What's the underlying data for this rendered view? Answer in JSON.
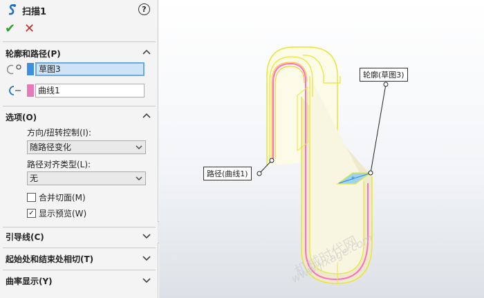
{
  "feature": {
    "title": "扫描1",
    "help": "?",
    "ok_icon": "checkmark-icon",
    "cancel_icon": "close-icon"
  },
  "profile_path": {
    "title": "轮廓和路径(P)",
    "profile": {
      "value": "草图3",
      "color": "#3d8fe0"
    },
    "path": {
      "value": "曲线1",
      "color": "#e879b8"
    }
  },
  "options": {
    "title": "选项(O)",
    "orientation_label": "方向/扭转控制(I):",
    "orientation_value": "随路径变化",
    "alignment_label": "路径对齐类型(L):",
    "alignment_value": "无",
    "merge_faces": {
      "label": "合并切面(M)",
      "checked": false
    },
    "show_preview": {
      "label": "显示预览(W)",
      "checked": true,
      "mark": "✓"
    }
  },
  "sections": {
    "guides": "引导线(C)",
    "tangency": "起始处和结束处相切(T)",
    "curvature": "曲率显示(Y)"
  },
  "viewport": {
    "callout_profile": "轮廓(草图3)",
    "callout_path": "路径(曲线1)",
    "watermark_cn": "机械时代网",
    "watermark_url": "www.jixage.com"
  }
}
